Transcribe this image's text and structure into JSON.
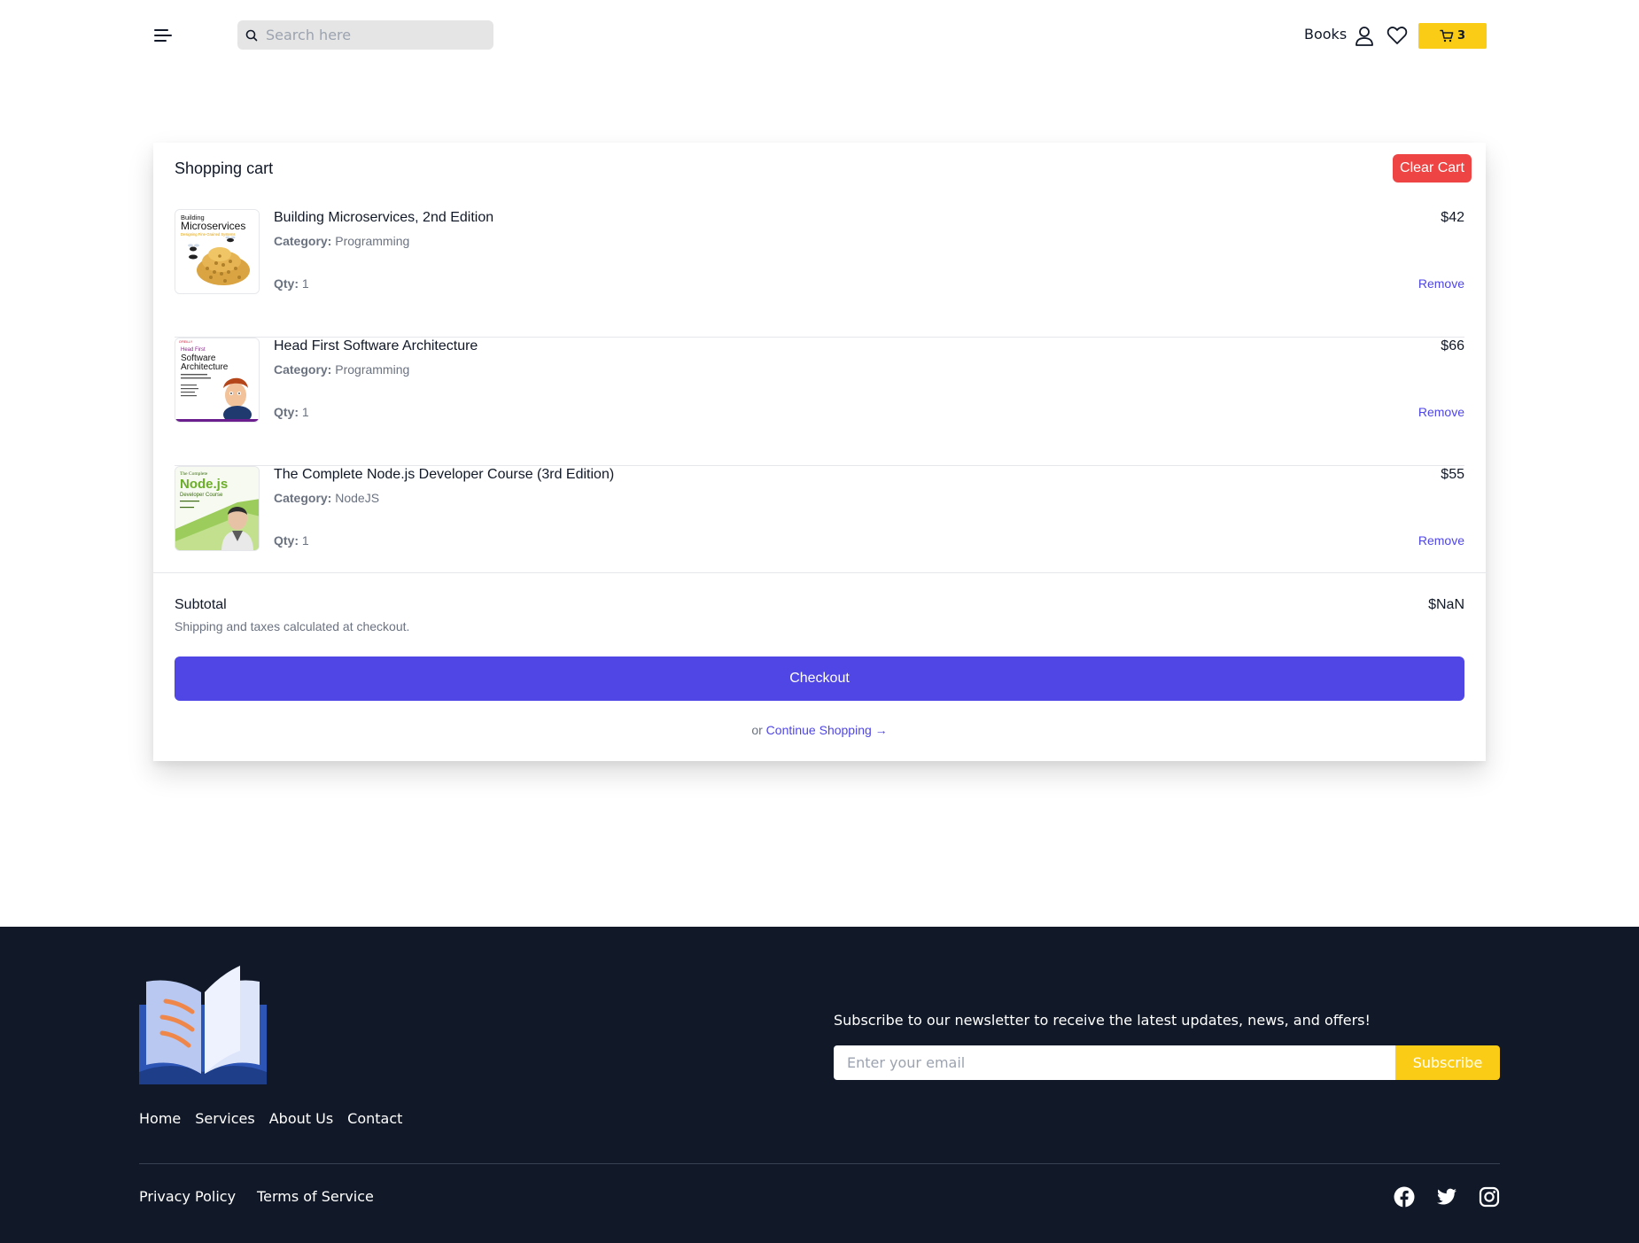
{
  "header": {
    "search_placeholder": "Search here",
    "books_label": "Books",
    "cart_count": "3"
  },
  "cart": {
    "title": "Shopping cart",
    "clear_label": "Clear Cart",
    "category_label": "Category:",
    "qty_label": "Qty:",
    "remove_label": "Remove",
    "items": [
      {
        "title": "Building Microservices, 2nd Edition",
        "category": "Programming",
        "qty": "1",
        "price": "$42"
      },
      {
        "title": "Head First Software Architecture",
        "category": "Programming",
        "qty": "1",
        "price": "$66"
      },
      {
        "title": "The Complete Node.js Developer Course (3rd Edition)",
        "category": "NodeJS",
        "qty": "1",
        "price": "$55"
      }
    ],
    "subtotal_label": "Subtotal",
    "subtotal_value": "$NaN",
    "subtotal_note": "Shipping and taxes calculated at checkout.",
    "checkout_label": "Checkout",
    "continue_prefix": "or",
    "continue_label": "Continue Shopping →"
  },
  "thumbnails": {
    "book1": {
      "line1": "Building",
      "line2": "Microservices",
      "line3": "Designing Fine-Grained Systems"
    },
    "book2": {
      "publisher": "O'REILLY",
      "series": "Head First",
      "line1": "Software",
      "line2": "Architecture"
    },
    "book3": {
      "line1": "The Complete",
      "line2": "Node.js",
      "line3": "Developer Course"
    }
  },
  "footer": {
    "links": [
      "Home",
      "Services",
      "About Us",
      "Contact"
    ],
    "newsletter_text": "Subscribe to our newsletter to receive the latest updates, news, and offers!",
    "email_placeholder": "Enter your email",
    "subscribe_label": "Subscribe",
    "legal": [
      "Privacy Policy",
      "Terms of Service"
    ]
  },
  "colors": {
    "accent": "#4f46e5",
    "danger": "#ef4444",
    "highlight": "#facc15",
    "footer_bg": "#111827"
  },
  "icons": {
    "menu": "menu-icon",
    "search": "search-icon",
    "user": "user-icon",
    "heart": "heart-icon",
    "cart": "cart-icon",
    "facebook": "facebook-icon",
    "twitter": "twitter-icon",
    "instagram": "instagram-icon"
  }
}
